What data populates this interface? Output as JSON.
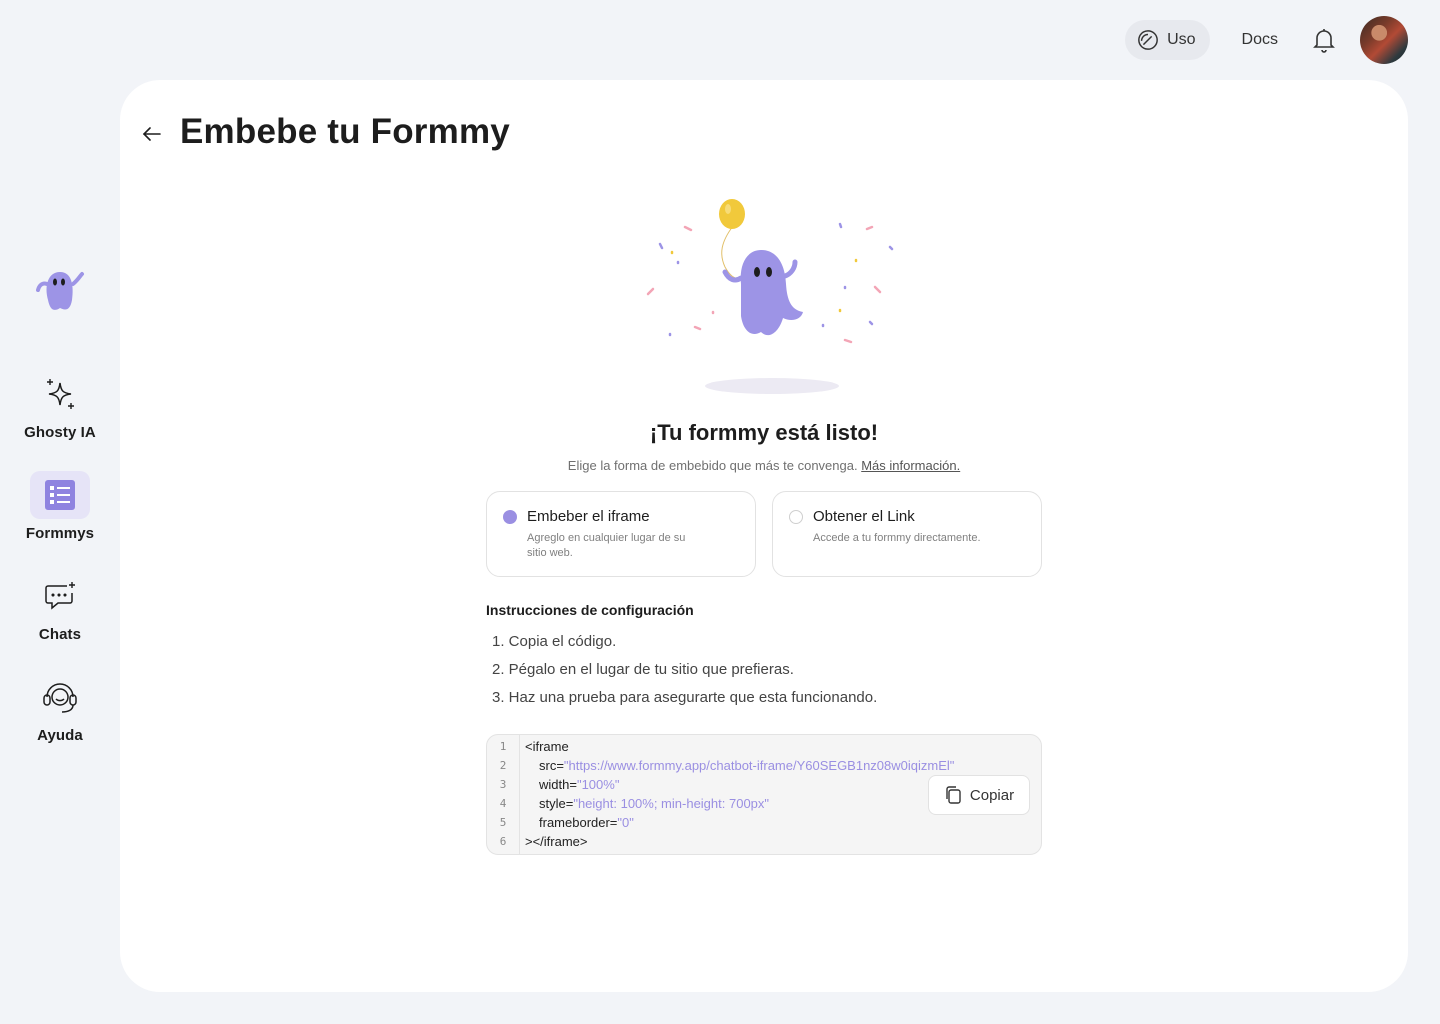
{
  "topbar": {
    "uso_label": "Uso",
    "docs_label": "Docs"
  },
  "sidebar": {
    "items": [
      {
        "label": "Ghosty IA",
        "icon": "sparkles-icon"
      },
      {
        "label": "Formmys",
        "icon": "list-icon",
        "active": true
      },
      {
        "label": "Chats",
        "icon": "chat-icon"
      },
      {
        "label": "Ayuda",
        "icon": "headset-icon"
      }
    ]
  },
  "page": {
    "title": "Embebe tu Formmy",
    "headline": "¡Tu formmy está listo!",
    "subline": "Elige la forma de embebido que más te convenga.",
    "more_info": "Más información."
  },
  "options": [
    {
      "title": "Embeber el iframe",
      "desc": "Agreglo en cualquier lugar de su sitio web.",
      "selected": true
    },
    {
      "title": "Obtener el Link",
      "desc": "Accede a tu formmy directamente.",
      "selected": false
    }
  ],
  "instructions": {
    "title": "Instrucciones de configuración",
    "steps": [
      "1. Copia el código.",
      "2. Pégalo en el lugar de tu sitio que prefieras.",
      "3. Haz una prueba para asegurarte que esta funcionando."
    ]
  },
  "code": {
    "line_numbers": [
      "1",
      "2",
      "3",
      "4",
      "5",
      "6"
    ],
    "open_tag": "<iframe",
    "src_attr": "src=",
    "src_val": "\"https://www.formmy.app/chatbot-iframe/Y60SEGB1nz08w0iqizmEl\"",
    "width_attr": "width=",
    "width_val": "\"100%\"",
    "style_attr": "style=",
    "style_val": "\"height: 100%; min-height: 700px\"",
    "frameborder_attr": "frameborder=",
    "frameborder_val": "\"0\"",
    "close_tag": "></iframe>",
    "copy_label": "Copiar"
  },
  "colors": {
    "accent": "#9a8fe2",
    "ghost": "#9d94e6",
    "background": "#f2f4f8"
  }
}
